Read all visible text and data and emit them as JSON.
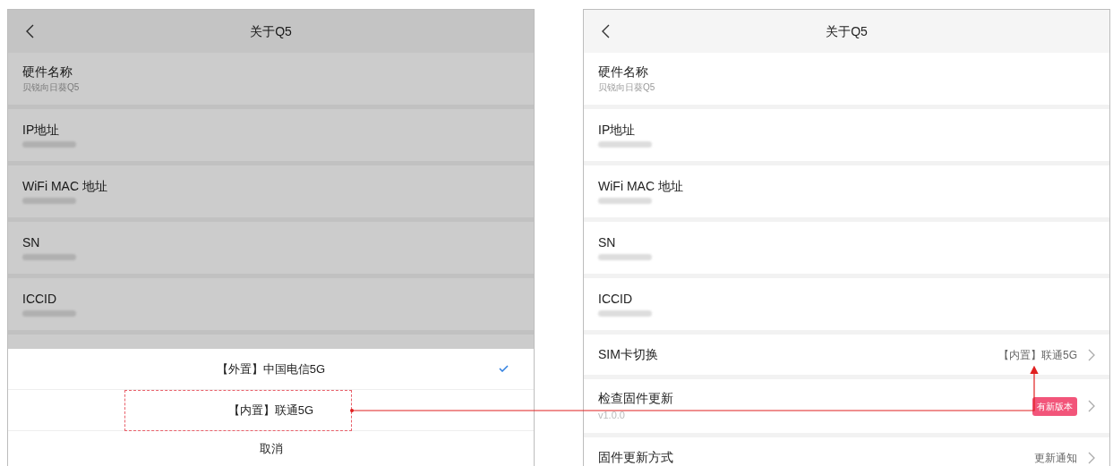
{
  "screens": [
    {
      "title": "关于Q5",
      "dimmed": true,
      "rows": [
        {
          "kind": "info",
          "label": "硬件名称",
          "value": "贝锐向日葵Q5"
        },
        {
          "kind": "redacted",
          "label": "IP地址"
        },
        {
          "kind": "redacted",
          "label": "WiFi MAC 地址"
        },
        {
          "kind": "redacted",
          "label": "SN"
        },
        {
          "kind": "redacted",
          "label": "ICCID"
        },
        {
          "kind": "covered"
        }
      ],
      "sheet": {
        "options": [
          {
            "label": "【外置】中国电信5G",
            "selected": true
          },
          {
            "label": "【内置】联通5G",
            "selected": false,
            "highlighted": true
          }
        ],
        "cancel": "取消"
      }
    },
    {
      "title": "关于Q5",
      "dimmed": false,
      "rows": [
        {
          "kind": "info",
          "label": "硬件名称",
          "value": "贝锐向日葵Q5"
        },
        {
          "kind": "redacted",
          "label": "IP地址"
        },
        {
          "kind": "redacted",
          "label": "WiFi MAC 地址"
        },
        {
          "kind": "redacted",
          "label": "SN"
        },
        {
          "kind": "redacted",
          "label": "ICCID"
        },
        {
          "kind": "link",
          "label": "SIM卡切换",
          "value": "【内置】联通5G",
          "target": true
        },
        {
          "kind": "update",
          "label": "检查固件更新",
          "value": "v1.0.0",
          "badge": "有新版本"
        },
        {
          "kind": "link",
          "label": "固件更新方式",
          "value": "更新通知"
        }
      ]
    }
  ]
}
